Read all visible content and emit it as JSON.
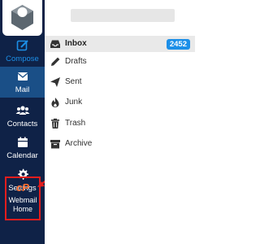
{
  "nav": {
    "items": [
      {
        "label": "Compose",
        "icon": "compose-icon"
      },
      {
        "label": "Mail",
        "icon": "envelope-icon"
      },
      {
        "label": "Contacts",
        "icon": "people-icon"
      },
      {
        "label": "Calendar",
        "icon": "calendar-icon"
      },
      {
        "label": "Settings",
        "icon": "gear-icon"
      }
    ],
    "webmail_home": {
      "logo": "cP",
      "line1": "Webmail",
      "line2": "Home",
      "icon": "cpanel-logo"
    }
  },
  "folders": [
    {
      "name": "Inbox",
      "icon": "inbox-icon",
      "badge": "2452"
    },
    {
      "name": "Drafts",
      "icon": "pencil-icon"
    },
    {
      "name": "Sent",
      "icon": "paper-plane-icon"
    },
    {
      "name": "Junk",
      "icon": "fire-icon"
    },
    {
      "name": "Trash",
      "icon": "trash-icon"
    },
    {
      "name": "Archive",
      "icon": "archive-box-icon"
    }
  ],
  "colors": {
    "sidebar_bg": "#0f2247",
    "active_bg": "#1a4f87",
    "accent": "#1c8fe8",
    "highlight_border": "#e21d1d",
    "cpanel_orange": "#ff6c2c"
  }
}
